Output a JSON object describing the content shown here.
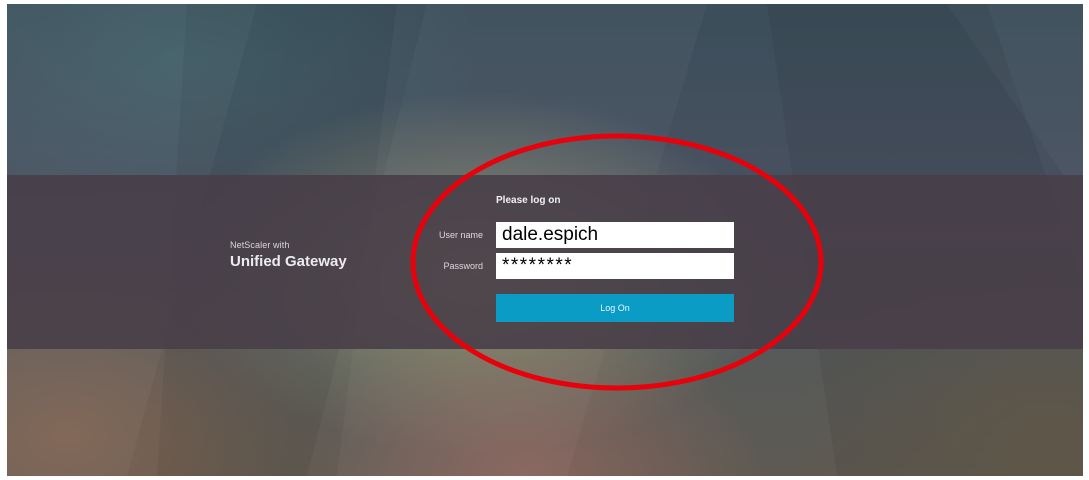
{
  "branding": {
    "line1": "NetScaler with",
    "line2": "Unified Gateway"
  },
  "login_form": {
    "prompt": "Please log on",
    "username_label": "User name",
    "username_value": "dale.espich",
    "password_label": "Password",
    "password_value": "********",
    "logon_button_label": "Log On"
  },
  "colors": {
    "band": "#483e48",
    "button": "#0a9cc4",
    "annotation": "#e8000b"
  }
}
